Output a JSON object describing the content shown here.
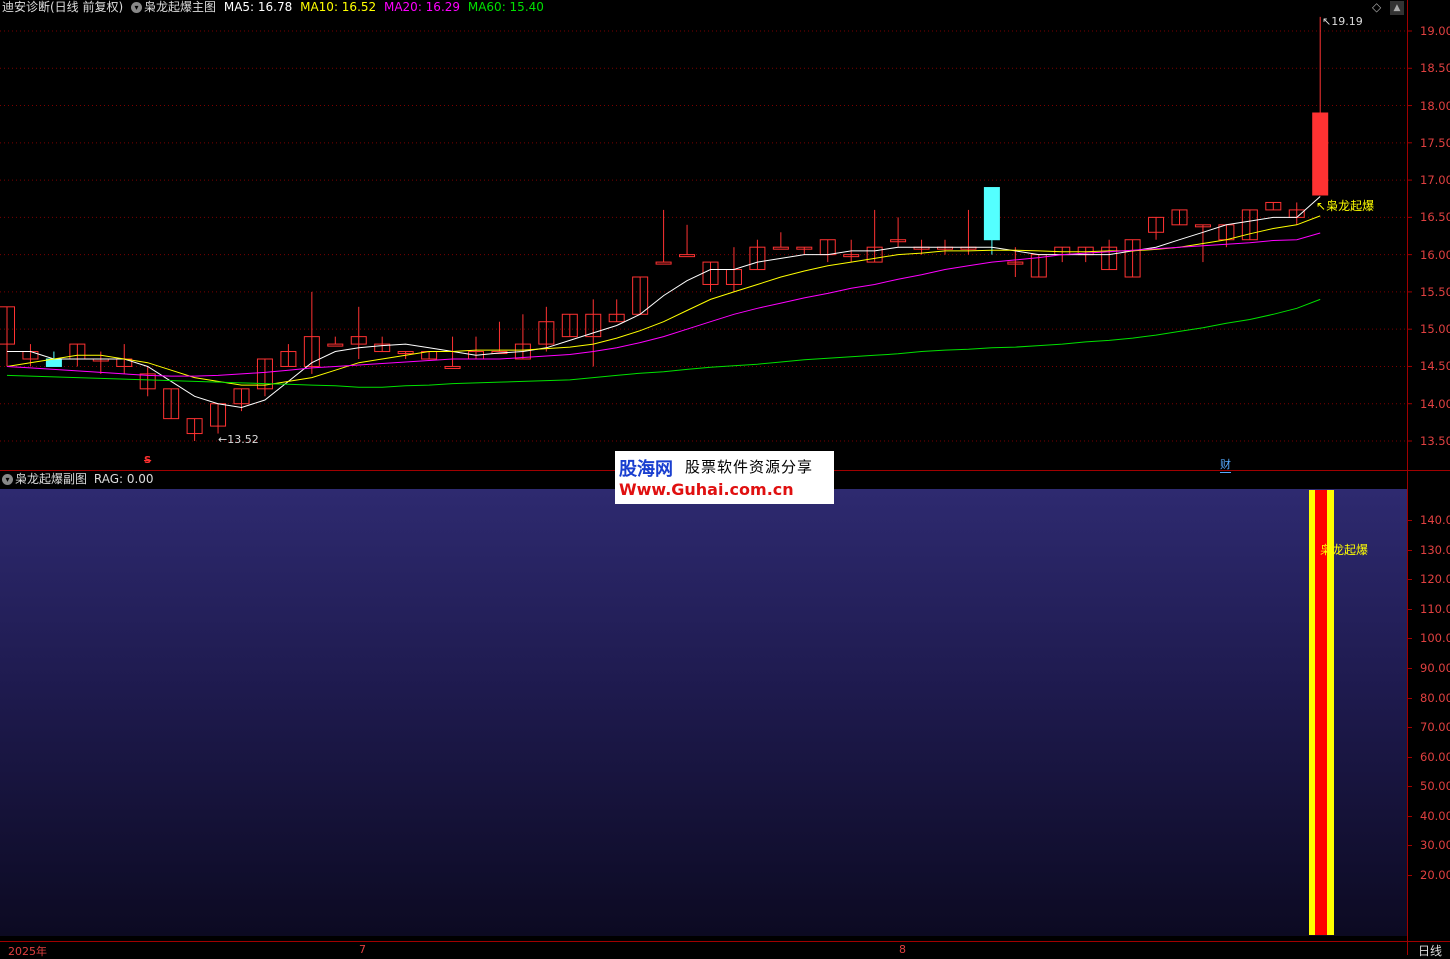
{
  "main_header": {
    "title": "迪安诊断(日线 前复权)",
    "indicator": "枭龙起爆主图",
    "ma5": "MA5: 16.78",
    "ma10": "MA10: 16.52",
    "ma20": "MA20: 16.29",
    "ma60": "MA60: 15.40"
  },
  "colors": {
    "ma5": "#ffffff",
    "ma10": "#ffff00",
    "ma20": "#ff00ff",
    "ma60": "#00e000",
    "up": "#ff3232",
    "down": "#54ffff",
    "grid": "#7a0000"
  },
  "price_axis": [
    "19.00",
    "18.50",
    "18.00",
    "17.50",
    "17.00",
    "16.50",
    "16.00",
    "15.50",
    "15.00",
    "14.50",
    "14.00",
    "13.50"
  ],
  "markers": {
    "high": "19.19",
    "low": "13.52",
    "signal": "枭龙起爆",
    "cai": "财",
    "s": "S"
  },
  "sub_header": {
    "title": "枭龙起爆副图",
    "rag": "RAG: 0.00"
  },
  "sub_axis": [
    "140.00",
    "130.00",
    "120.00",
    "110.00",
    "100.00",
    "90.00",
    "80.00",
    "70.00",
    "60.00",
    "50.00",
    "40.00",
    "30.00",
    "20.00"
  ],
  "sub_signal": "枭龙起爆",
  "time_axis": {
    "start": "2025年",
    "m7": "7",
    "m8": "8"
  },
  "period_tab": "日线",
  "watermark": {
    "title": "股海网",
    "slogan": "股票软件资源分享",
    "url": "Www.Guhai.com.cn"
  },
  "chart_data": {
    "type": "candlestick",
    "title": "枭龙起爆主图",
    "y_range": [
      13.3,
      19.2
    ],
    "candles": [
      [
        14.8,
        15.3,
        14.5,
        15.3
      ],
      [
        14.6,
        14.8,
        14.5,
        14.7
      ],
      [
        14.6,
        14.7,
        14.5,
        14.5
      ],
      [
        14.6,
        14.8,
        14.5,
        14.8
      ],
      [
        14.6,
        14.7,
        14.4,
        14.6
      ],
      [
        14.5,
        14.8,
        14.4,
        14.6
      ],
      [
        14.2,
        14.5,
        14.1,
        14.4
      ],
      [
        13.8,
        14.2,
        13.8,
        14.2
      ],
      [
        13.6,
        13.8,
        13.5,
        13.8
      ],
      [
        13.7,
        14.0,
        13.6,
        14.0
      ],
      [
        14.0,
        14.2,
        13.9,
        14.2
      ],
      [
        14.2,
        14.6,
        14.1,
        14.6
      ],
      [
        14.5,
        14.8,
        14.5,
        14.7
      ],
      [
        14.5,
        15.5,
        14.4,
        14.9
      ],
      [
        14.8,
        14.9,
        14.8,
        14.8
      ],
      [
        14.8,
        15.3,
        14.6,
        14.9
      ],
      [
        14.7,
        14.9,
        14.7,
        14.8
      ],
      [
        14.7,
        14.7,
        14.6,
        14.7
      ],
      [
        14.6,
        14.7,
        14.6,
        14.7
      ],
      [
        14.5,
        14.9,
        14.5,
        14.5
      ],
      [
        14.6,
        14.9,
        14.6,
        14.7
      ],
      [
        14.7,
        15.1,
        14.7,
        14.7
      ],
      [
        14.6,
        15.2,
        14.6,
        14.8
      ],
      [
        14.8,
        15.3,
        14.7,
        15.1
      ],
      [
        14.9,
        15.2,
        14.9,
        15.2
      ],
      [
        14.9,
        15.4,
        14.5,
        15.2
      ],
      [
        15.1,
        15.4,
        15.1,
        15.2
      ],
      [
        15.2,
        15.7,
        15.2,
        15.7
      ],
      [
        15.9,
        16.6,
        15.9,
        15.9
      ],
      [
        16.0,
        16.4,
        16.0,
        16.0
      ],
      [
        15.6,
        15.9,
        15.5,
        15.9
      ],
      [
        15.6,
        16.1,
        15.5,
        15.8
      ],
      [
        15.8,
        16.2,
        15.8,
        16.1
      ],
      [
        16.1,
        16.3,
        16.1,
        16.1
      ],
      [
        16.1,
        16.1,
        16.0,
        16.1
      ],
      [
        16.0,
        16.2,
        15.9,
        16.2
      ],
      [
        16.0,
        16.2,
        15.9,
        16.0
      ],
      [
        15.9,
        16.6,
        15.9,
        16.1
      ],
      [
        16.2,
        16.5,
        16.1,
        16.2
      ],
      [
        16.1,
        16.2,
        16.0,
        16.1
      ],
      [
        16.1,
        16.2,
        16.0,
        16.1
      ],
      [
        16.1,
        16.6,
        16.0,
        16.1
      ],
      [
        16.9,
        16.9,
        16.0,
        16.2
      ],
      [
        15.9,
        16.1,
        15.7,
        15.9
      ],
      [
        15.7,
        16.0,
        15.7,
        16.0
      ],
      [
        16.0,
        16.1,
        15.9,
        16.1
      ],
      [
        16.0,
        16.1,
        15.9,
        16.1
      ],
      [
        15.8,
        16.2,
        15.8,
        16.1
      ],
      [
        15.7,
        16.2,
        15.7,
        16.2
      ],
      [
        16.3,
        16.5,
        16.2,
        16.5
      ],
      [
        16.4,
        16.6,
        16.4,
        16.6
      ],
      [
        16.4,
        16.4,
        15.9,
        16.4
      ],
      [
        16.2,
        16.4,
        16.1,
        16.4
      ],
      [
        16.2,
        16.6,
        16.2,
        16.6
      ],
      [
        16.6,
        16.7,
        16.6,
        16.7
      ],
      [
        16.5,
        16.7,
        16.4,
        16.6
      ],
      [
        16.8,
        19.19,
        16.8,
        17.9
      ]
    ],
    "series": [
      {
        "name": "MA5",
        "values": [
          14.7,
          14.7,
          14.6,
          14.6,
          14.6,
          14.6,
          14.5,
          14.3,
          14.1,
          14.0,
          13.95,
          14.05,
          14.3,
          14.55,
          14.7,
          14.75,
          14.78,
          14.8,
          14.75,
          14.7,
          14.65,
          14.68,
          14.7,
          14.75,
          14.85,
          14.95,
          15.05,
          15.2,
          15.45,
          15.65,
          15.8,
          15.8,
          15.9,
          15.95,
          16.0,
          16.0,
          16.05,
          16.05,
          16.1,
          16.1,
          16.1,
          16.1,
          16.1,
          16.05,
          16.0,
          16.0,
          16.0,
          16.0,
          16.05,
          16.1,
          16.2,
          16.3,
          16.4,
          16.45,
          16.5,
          16.5,
          16.78
        ]
      },
      {
        "name": "MA10",
        "values": [
          14.5,
          14.55,
          14.6,
          14.65,
          14.65,
          14.6,
          14.55,
          14.45,
          14.35,
          14.3,
          14.25,
          14.25,
          14.3,
          14.35,
          14.45,
          14.55,
          14.6,
          14.65,
          14.7,
          14.7,
          14.72,
          14.72,
          14.72,
          14.74,
          14.76,
          14.8,
          14.88,
          14.98,
          15.1,
          15.25,
          15.4,
          15.5,
          15.6,
          15.7,
          15.78,
          15.85,
          15.9,
          15.95,
          16.0,
          16.02,
          16.05,
          16.05,
          16.06,
          16.06,
          16.05,
          16.04,
          16.04,
          16.05,
          16.05,
          16.07,
          16.1,
          16.15,
          16.2,
          16.28,
          16.35,
          16.4,
          16.52
        ]
      },
      {
        "name": "MA20",
        "values": [
          14.5,
          14.48,
          14.46,
          14.44,
          14.42,
          14.4,
          14.38,
          14.37,
          14.37,
          14.38,
          14.4,
          14.42,
          14.45,
          14.48,
          14.5,
          14.52,
          14.54,
          14.56,
          14.58,
          14.6,
          14.6,
          14.6,
          14.62,
          14.64,
          14.66,
          14.7,
          14.75,
          14.82,
          14.9,
          15.0,
          15.1,
          15.2,
          15.28,
          15.35,
          15.42,
          15.48,
          15.55,
          15.6,
          15.67,
          15.73,
          15.8,
          15.85,
          15.9,
          15.93,
          15.96,
          16.0,
          16.02,
          16.04,
          16.06,
          16.08,
          16.1,
          16.12,
          16.14,
          16.16,
          16.19,
          16.2,
          16.29
        ]
      },
      {
        "name": "MA60",
        "values": [
          14.38,
          14.37,
          14.36,
          14.35,
          14.34,
          14.33,
          14.32,
          14.31,
          14.3,
          14.29,
          14.28,
          14.27,
          14.26,
          14.25,
          14.24,
          14.22,
          14.22,
          14.24,
          14.25,
          14.27,
          14.28,
          14.29,
          14.3,
          14.31,
          14.32,
          14.35,
          14.38,
          14.41,
          14.43,
          14.46,
          14.49,
          14.51,
          14.53,
          14.56,
          14.59,
          14.61,
          14.63,
          14.65,
          14.67,
          14.7,
          14.72,
          14.73,
          14.75,
          14.76,
          14.78,
          14.8,
          14.83,
          14.85,
          14.88,
          14.92,
          14.97,
          15.02,
          15.08,
          15.13,
          15.2,
          15.28,
          15.4
        ]
      }
    ]
  }
}
